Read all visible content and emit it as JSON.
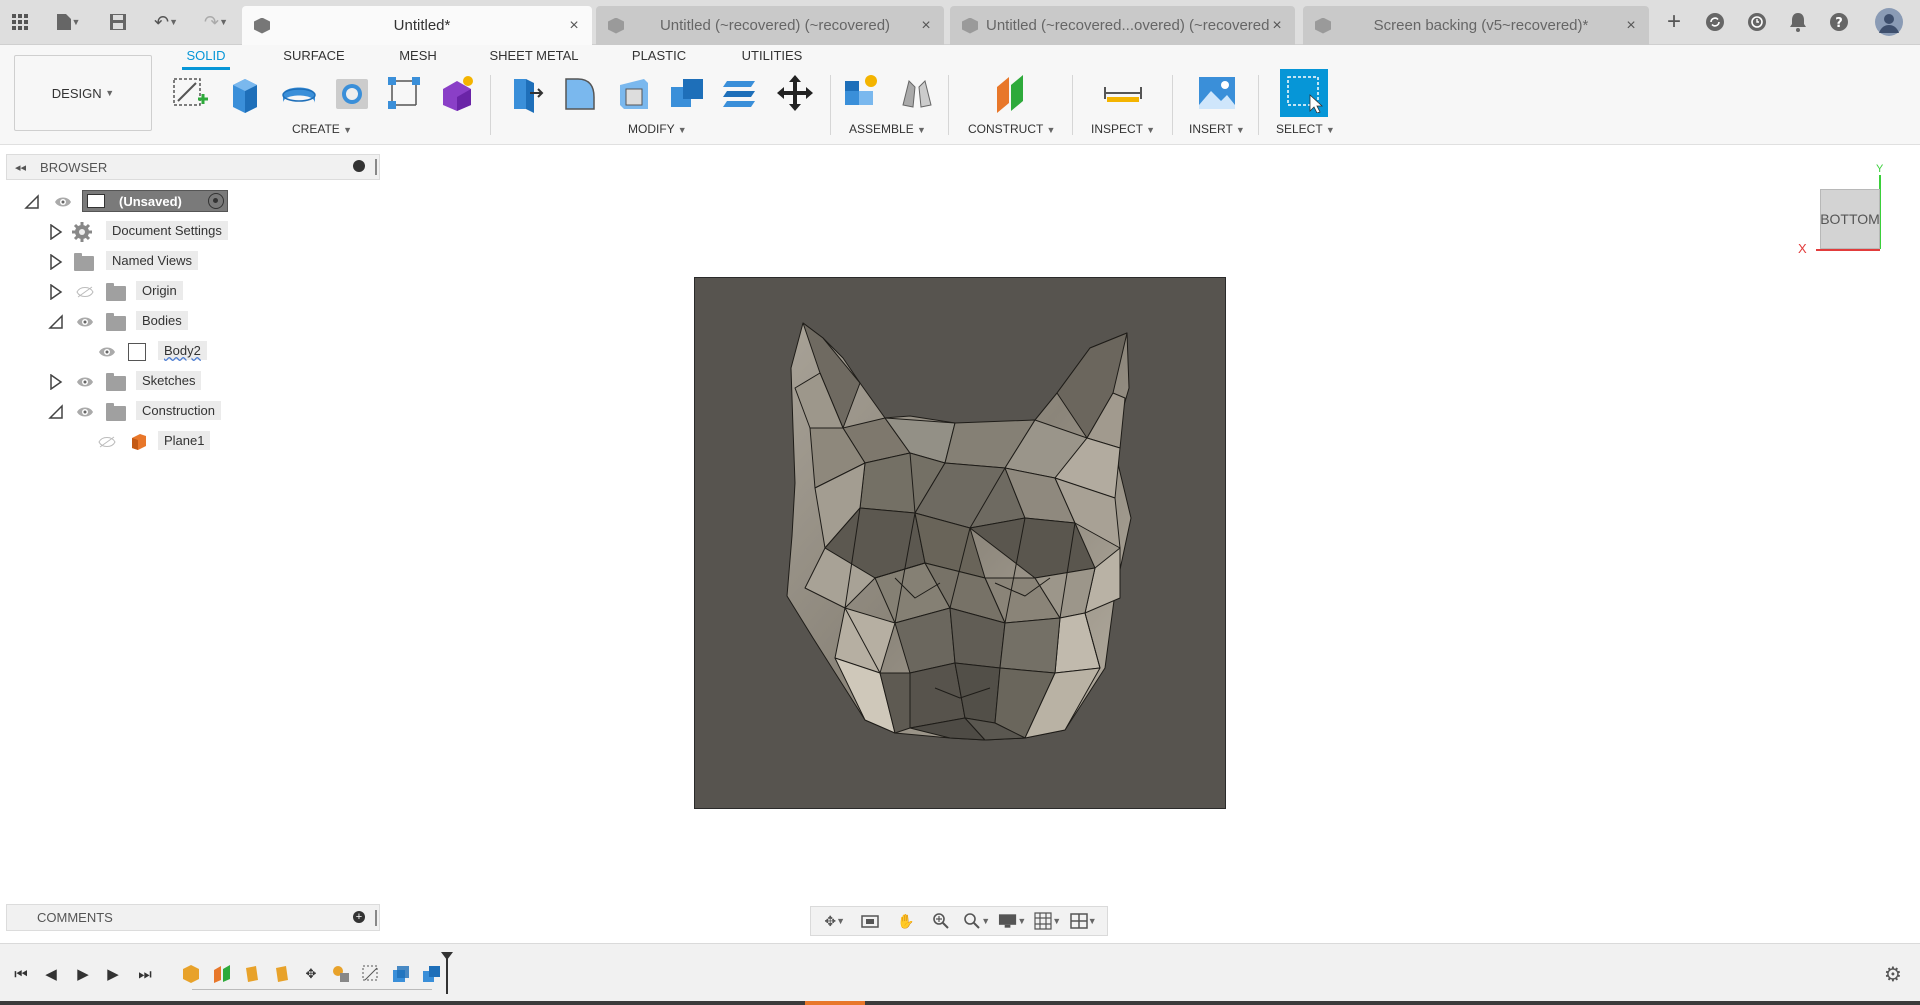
{
  "tabbar": {
    "tabs": [
      {
        "label": "Untitled*",
        "active": true
      },
      {
        "label": "Untitled (~recovered) (~recovered)",
        "active": false
      },
      {
        "label": "Untitled (~recovered...overed) (~recovered)",
        "active": false
      },
      {
        "label": "Screen backing (v5~recovered)*",
        "active": false
      }
    ],
    "close_glyph": "×",
    "new_tab_glyph": "+"
  },
  "toolbar": {
    "workspace_label": "DESIGN",
    "workspace_tabs": [
      {
        "label": "SOLID",
        "active": true
      },
      {
        "label": "SURFACE",
        "active": false
      },
      {
        "label": "MESH",
        "active": false
      },
      {
        "label": "SHEET METAL",
        "active": false
      },
      {
        "label": "PLASTIC",
        "active": false
      },
      {
        "label": "UTILITIES",
        "active": false
      }
    ],
    "groups": {
      "create": "CREATE",
      "modify": "MODIFY",
      "assemble": "ASSEMBLE",
      "construct": "CONSTRUCT",
      "inspect": "INSPECT",
      "insert": "INSERT",
      "select": "SELECT"
    },
    "colors": {
      "accent": "#0696d7",
      "select_bg": "#0696d7"
    }
  },
  "browser": {
    "title": "BROWSER",
    "root": "(Unsaved)",
    "nodes": {
      "document_settings": "Document Settings",
      "named_views": "Named Views",
      "origin": "Origin",
      "bodies": "Bodies",
      "body2": "Body2",
      "sketches": "Sketches",
      "construction": "Construction",
      "plane1": "Plane1"
    }
  },
  "comments": {
    "title": "COMMENTS"
  },
  "viewcube": {
    "face": "BOTTOM",
    "axis_x": "X",
    "axis_y": "Y"
  },
  "viewport": {
    "background": "#57544f",
    "model": "low-poly cat face mesh"
  }
}
